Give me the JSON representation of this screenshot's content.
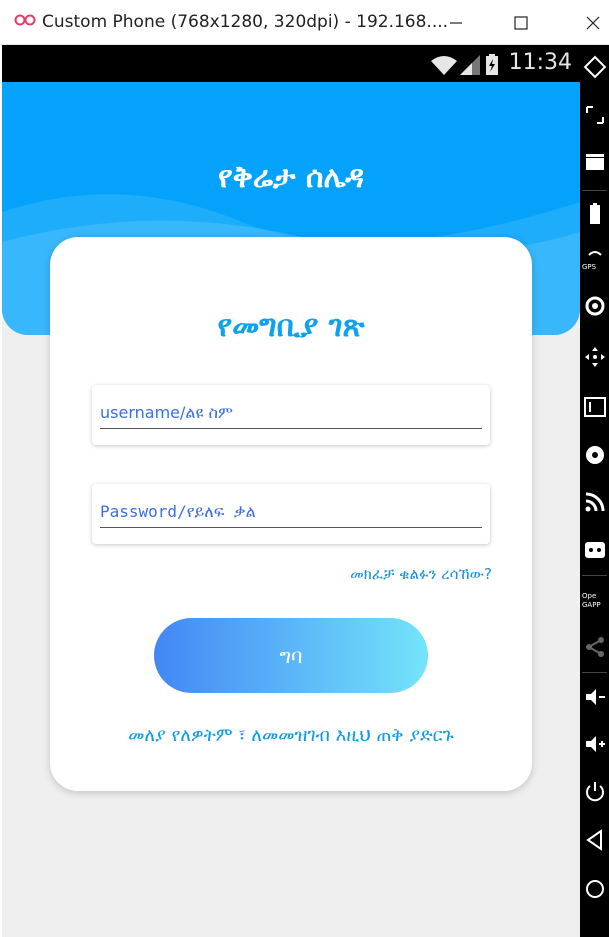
{
  "window": {
    "title": "Custom Phone (768x1280, 320dpi) - 192.168....",
    "controls": [
      "minimize",
      "maximize",
      "close"
    ]
  },
  "statusbar": {
    "time": "11:34",
    "icons": [
      "wifi-icon",
      "signal-icon",
      "battery-icon"
    ]
  },
  "header": {
    "title": "የቅሬታ ሰሌዳ"
  },
  "login": {
    "title": "የመግቢያ ገጽ",
    "username_placeholder": "username/ልዩ ስም",
    "password_placeholder": "Password/የይለፍ ቃል",
    "forgot_password": "መክፈቻ ቁልፉን ረሳኸው?",
    "login_button": "ግባ",
    "register_link": "መለያ የለዎትም ፣ ለመመዝገብ እዚህ ጠቅ ያድርጉ"
  },
  "sidebar": {
    "opengapps_label_1": "Ope",
    "opengapps_label_2": "GAPP",
    "gps_label": "GPS",
    "icons": [
      "rotate-icon",
      "resize-icon",
      "video-icon",
      "battery-icon",
      "gps-icon",
      "camera-icon",
      "move-icon",
      "id-icon",
      "disk-icon",
      "rss-icon",
      "more-icon",
      "opengapps-icon",
      "share-icon",
      "volume-down-icon",
      "volume-up-icon",
      "power-icon",
      "back-icon",
      "home-icon"
    ]
  },
  "colors": {
    "header": "#04a2fb",
    "accent": "#0ea1f0",
    "button_gradient_start": "#4287f5",
    "button_gradient_end": "#74e4fb"
  }
}
